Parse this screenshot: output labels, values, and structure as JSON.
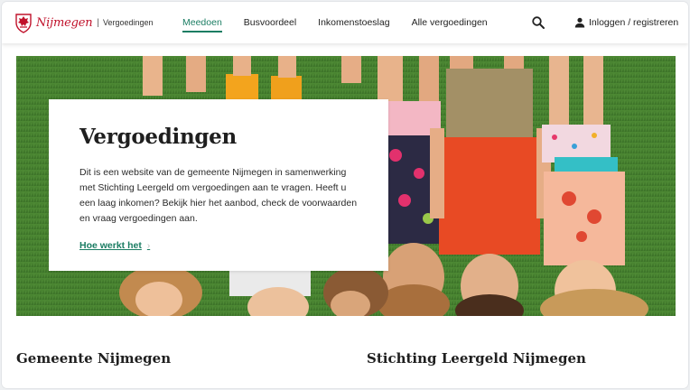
{
  "header": {
    "logo_word": "Nijmegen",
    "logo_sep": "|",
    "logo_sub": "Vergoedingen",
    "nav": [
      {
        "label": "Meedoen",
        "active": true
      },
      {
        "label": "Busvoordeel",
        "active": false
      },
      {
        "label": "Inkomenstoeslag",
        "active": false
      },
      {
        "label": "Alle vergoedingen",
        "active": false
      }
    ],
    "login_label": "Inloggen / registreren"
  },
  "hero": {
    "title": "Vergoedingen",
    "text": "Dit is een website van de gemeente Nijmegen in samenwerking met Stichting Leergeld om vergoedingen aan te vragen. Heeft u een laag inkomen? Bekijk hier het aanbod, check de voorwaarden en vraag vergoedingen aan.",
    "link_label": "Hoe werkt het",
    "link_chevron": "›"
  },
  "sections": {
    "left_title": "Gemeente Nijmegen",
    "right_title": "Stichting Leergeld Nijmegen"
  },
  "colors": {
    "brand_red": "#c0122b",
    "accent_green": "#1b7d63",
    "grass": "#3f7a2c"
  },
  "icons": {
    "search": "search-icon",
    "user": "user-icon",
    "crest": "crest-icon"
  }
}
